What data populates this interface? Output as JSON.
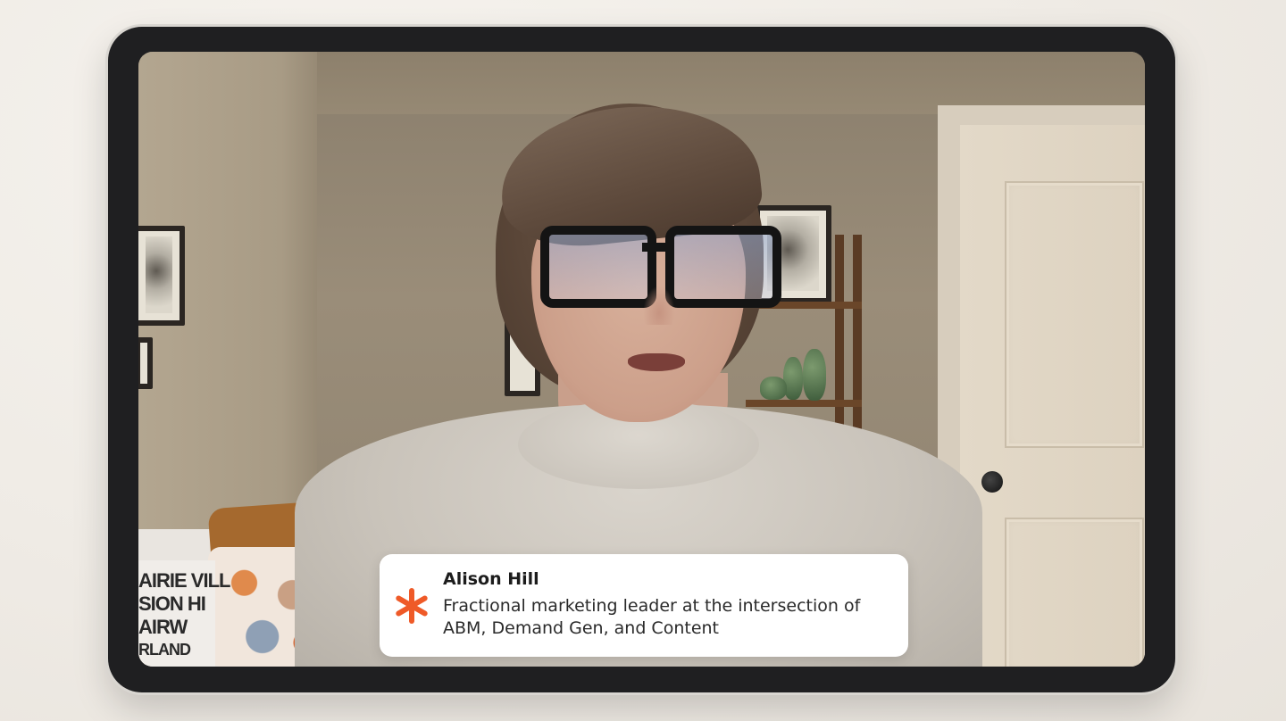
{
  "speaker": {
    "name": "Alison Hill",
    "description": "Fractional marketing leader at the intersection of ABM, Demand Gen, and Content"
  },
  "icons": {
    "brand": "asterisk-icon"
  },
  "colors": {
    "accent": "#ef5a28",
    "device_bezel": "#1f1f21",
    "background": "#efebe5",
    "caption_background": "#ffffff"
  },
  "scene": {
    "pillow_text_lines": [
      "AIRIE VILL",
      "SION HI",
      "AIRW",
      "RLAND"
    ]
  }
}
